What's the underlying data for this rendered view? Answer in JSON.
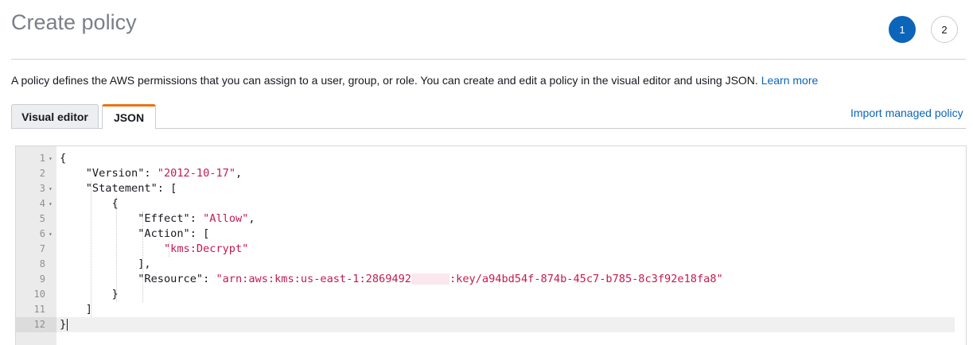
{
  "header": {
    "title": "Create policy"
  },
  "steps": [
    {
      "label": "1",
      "active": true
    },
    {
      "label": "2",
      "active": false
    }
  ],
  "description": {
    "text": "A policy defines the AWS permissions that you can assign to a user, group, or role. You can create and edit a policy in the visual editor and using JSON.",
    "link": "Learn more"
  },
  "tabs": [
    {
      "label": "Visual editor",
      "active": false
    },
    {
      "label": "JSON",
      "active": true
    }
  ],
  "import_link": "Import managed policy",
  "editor": {
    "lines": [
      {
        "num": "1",
        "fold": true
      },
      {
        "num": "2",
        "fold": false
      },
      {
        "num": "3",
        "fold": true
      },
      {
        "num": "4",
        "fold": true
      },
      {
        "num": "5",
        "fold": false
      },
      {
        "num": "6",
        "fold": true
      },
      {
        "num": "7",
        "fold": false
      },
      {
        "num": "8",
        "fold": false
      },
      {
        "num": "9",
        "fold": false
      },
      {
        "num": "10",
        "fold": false
      },
      {
        "num": "11",
        "fold": false
      },
      {
        "num": "12",
        "fold": false,
        "current": true
      }
    ],
    "tokens": {
      "open_brace": "{",
      "version_key": "\"Version\"",
      "version_val": "\"2012-10-17\"",
      "statement_key": "\"Statement\"",
      "open_bracket": "[",
      "inner_open_brace": "{",
      "effect_key": "\"Effect\"",
      "effect_val": "\"Allow\"",
      "action_key": "\"Action\"",
      "action_open": "[",
      "action_val": "\"kms:Decrypt\"",
      "action_close": "],",
      "resource_key": "\"Resource\"",
      "resource_val_start": "\"arn:aws:kms:us-east-1:2869492",
      "resource_val_end": ":key/a94bd54f-874b-45c7-b785-8c3f92e18fa8\"",
      "inner_close_brace": "}",
      "close_bracket": "]",
      "close_brace": "}"
    }
  },
  "colors": {
    "accent": "#0b65b8",
    "tab_active_border": "#ec7211",
    "string": "#c41a4e"
  }
}
